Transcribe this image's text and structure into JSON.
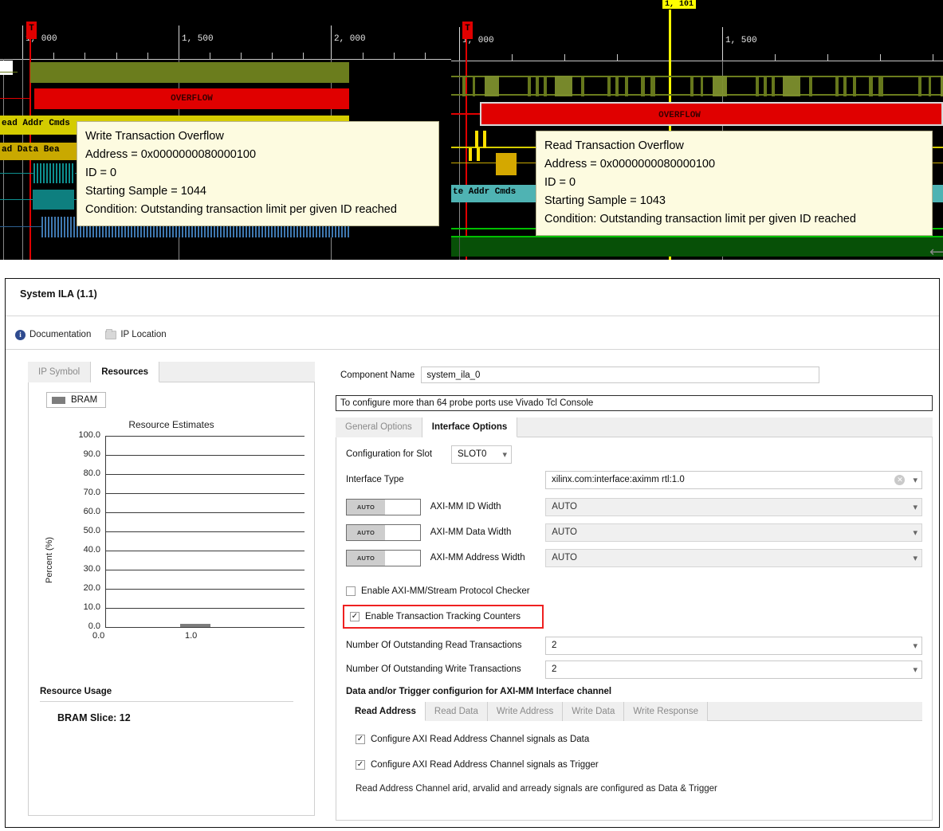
{
  "waveform_left": {
    "name": "write-transaction-waveform",
    "trigger_marker": "T",
    "ruler_labels": [
      "1, 000",
      "1, 500",
      "2, 000"
    ],
    "signal_labels": [
      "ead Addr Cmds",
      "ad Data Bea"
    ],
    "overflow_label": "OVERFLOW",
    "tooltip": {
      "title": "Write Transaction Overflow",
      "address": "Address = 0x0000000080000100",
      "id": "ID = 0",
      "starting_sample": "Starting Sample = 1044",
      "condition": "Condition: Outstanding transaction limit per given ID reached"
    }
  },
  "waveform_right": {
    "name": "read-transaction-waveform",
    "trigger_marker": "T",
    "marker_label": "1, 101",
    "ruler_labels": [
      "1, 000",
      "1, 500"
    ],
    "signal_labels": [
      "te Addr Cmds"
    ],
    "overflow_label": "OVERFLOW",
    "tooltip": {
      "title": "Read Transaction Overflow",
      "address": "Address = 0x0000000080000100",
      "id": "ID = 0",
      "starting_sample": "Starting Sample = 1043",
      "condition": "Condition: Outstanding transaction limit per given ID reached"
    }
  },
  "dialog": {
    "title": "System ILA (1.1)",
    "links": [
      {
        "label": "Documentation",
        "icon": "info-icon"
      },
      {
        "label": "IP Location",
        "icon": "folder-icon"
      }
    ],
    "left_tabs": [
      {
        "label": "IP Symbol",
        "active": false
      },
      {
        "label": "Resources",
        "active": true
      }
    ],
    "legend_label": "BRAM",
    "resource_usage_title": "Resource Usage",
    "resource_usage_value": "BRAM Slice: 12",
    "component_name_label": "Component Name",
    "component_name_value": "system_ila_0",
    "note_bar": "To configure more than 64 probe ports use Vivado Tcl Console",
    "sub_tabs": [
      {
        "label": "General Options",
        "active": false
      },
      {
        "label": "Interface Options",
        "active": true
      }
    ],
    "slot_label": "Configuration for Slot",
    "slot_value": "SLOT0",
    "interface_type_label": "Interface Type",
    "interface_type_value": "xilinx.com:interface:aximm rtl:1.0",
    "auto_rows": [
      {
        "toggle": "AUTO",
        "label": "AXI-MM ID Width",
        "value": "AUTO"
      },
      {
        "toggle": "AUTO",
        "label": "AXI-MM Data Width",
        "value": "AUTO"
      },
      {
        "toggle": "AUTO",
        "label": "AXI-MM Address Width",
        "value": "AUTO"
      }
    ],
    "checkbox_protocol_checker": {
      "label": "Enable AXI-MM/Stream Protocol Checker",
      "checked": false
    },
    "checkbox_tracking_counters": {
      "label": "Enable Transaction Tracking Counters",
      "checked": true,
      "highlight_color": "#ef2020"
    },
    "outstanding_read_label": "Number Of Outstanding Read Transactions",
    "outstanding_read_value": "2",
    "outstanding_write_label": "Number Of Outstanding Write Transactions",
    "outstanding_write_value": "2",
    "channel_section_title": "Data and/or Trigger configurion for AXI-MM Interface channel",
    "channel_tabs": [
      {
        "label": "Read Address",
        "active": true
      },
      {
        "label": "Read Data",
        "active": false
      },
      {
        "label": "Write Address",
        "active": false
      },
      {
        "label": "Write Data",
        "active": false
      },
      {
        "label": "Write Response",
        "active": false
      }
    ],
    "channel_checkbox_data": {
      "label": "Configure AXI Read Address Channel signals as Data",
      "checked": true
    },
    "channel_checkbox_trigger": {
      "label": "Configure AXI Read Address Channel signals as Trigger",
      "checked": true
    },
    "channel_note": "Read Address Channel arid, arvalid and arready signals are configured as Data & Trigger"
  },
  "chart_data": {
    "type": "bar",
    "title": "Resource Estimates",
    "xlabel": "",
    "ylabel": "Percent (%)",
    "categories": [
      "0.0",
      "1.0"
    ],
    "xtick_labels": [
      "0.0",
      "1.0"
    ],
    "ytick_labels": [
      "0.0",
      "10.0",
      "20.0",
      "30.0",
      "40.0",
      "50.0",
      "60.0",
      "70.0",
      "80.0",
      "90.0",
      "100.0"
    ],
    "series": [
      {
        "name": "BRAM",
        "values": [
          0,
          1.2
        ],
        "color": "#7d7d7d"
      }
    ],
    "ylim": [
      0,
      100
    ],
    "grid": true,
    "legend_position": "top-left"
  }
}
